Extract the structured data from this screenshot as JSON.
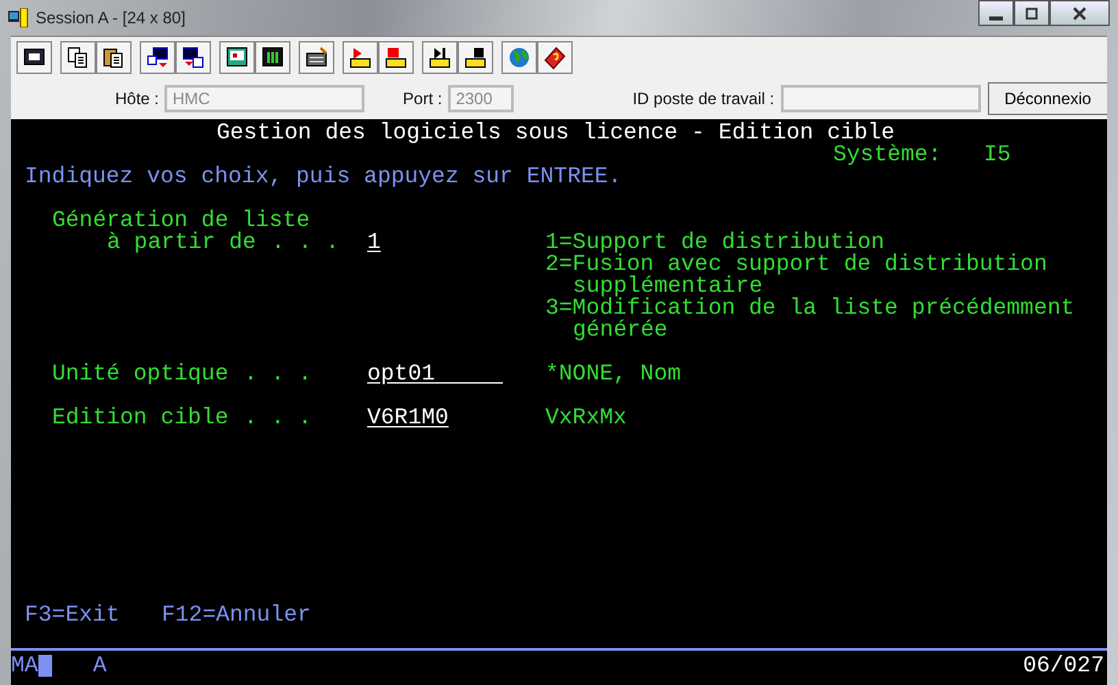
{
  "window": {
    "title": "Session A - [24 x 80]"
  },
  "connection": {
    "host_label": "Hôte :",
    "host_value": "HMC",
    "port_label": "Port :",
    "port_value": "2300",
    "workstation_label": "ID poste de travail :",
    "disconnect_button": "Déconnexio"
  },
  "screen": {
    "title": "Gestion des logiciels sous licence - Edition cible",
    "system_label": "Système:",
    "system_value": "I5",
    "instruction": "Indiquez vos choix, puis appuyez sur ENTREE.",
    "fields": [
      {
        "label_lines": [
          "Génération de liste",
          "à partir de"
        ],
        "dots": ". . .",
        "value": "1",
        "hints": [
          [
            "1=Support de distribution"
          ],
          [
            "2=Fusion avec support de distribution",
            "supplémentaire"
          ],
          [
            "3=Modification de la liste précédemment",
            "générée"
          ]
        ]
      },
      {
        "label_lines": [
          "Unité optique"
        ],
        "dots": ". . .",
        "value": "opt01     ",
        "hints": [
          [
            "*NONE, Nom"
          ]
        ]
      },
      {
        "label_lines": [
          "Edition cible"
        ],
        "dots": ". . .",
        "value": "V6R1M0",
        "hints": [
          [
            "VxRxMx"
          ]
        ]
      }
    ],
    "function_keys": [
      "F3=Exit",
      "F12=Annuler"
    ]
  },
  "status_bar": {
    "mode": "MA",
    "indicator": "A",
    "cursor_position": "06/027"
  }
}
